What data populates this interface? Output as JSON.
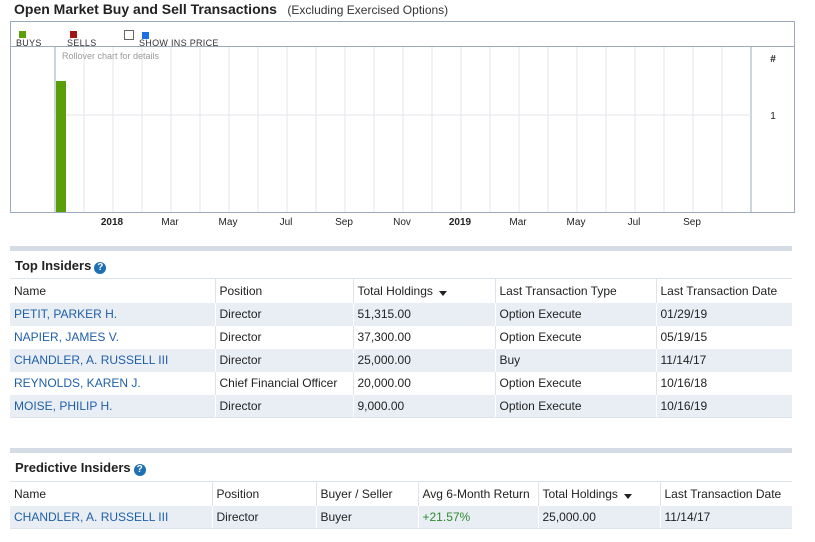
{
  "header": {
    "title": "Open Market Buy and Sell Transactions",
    "subtitle": "(Excluding Exercised Options)"
  },
  "legend": {
    "buys": "BUYS",
    "sells": "SELLS",
    "show_ins_price": "SHOW INS PRICE",
    "buys_color": "#5a9e0a",
    "sells_color": "#a31515",
    "price_color": "#1e6fe0"
  },
  "chart_data": {
    "type": "bar",
    "hint": "Rollover chart for details",
    "y_axis_label": "#",
    "y_ticks": [
      1
    ],
    "x_tick_labels": [
      {
        "label": "2018",
        "bold": true
      },
      {
        "label": "Mar",
        "bold": false
      },
      {
        "label": "May",
        "bold": false
      },
      {
        "label": "Jul",
        "bold": false
      },
      {
        "label": "Sep",
        "bold": false
      },
      {
        "label": "Nov",
        "bold": false
      },
      {
        "label": "2019",
        "bold": true
      },
      {
        "label": "Mar",
        "bold": false
      },
      {
        "label": "May",
        "bold": false
      },
      {
        "label": "Jul",
        "bold": false
      },
      {
        "label": "Sep",
        "bold": false
      }
    ],
    "series": [
      {
        "name": "BUYS",
        "color": "#5a9e0a",
        "points": [
          {
            "month_index": 0,
            "value": 1.35
          }
        ]
      }
    ],
    "ylim": [
      0,
      1.7
    ],
    "grid": true
  },
  "top_insiders": {
    "title": "Top Insiders",
    "columns": [
      "Name",
      "Position",
      "Total Holdings",
      "Last Transaction Type",
      "Last Transaction Date"
    ],
    "rows": [
      {
        "name": "PETIT, PARKER H.",
        "position": "Director",
        "holdings": "51,315.00",
        "type": "Option Execute",
        "date": "01/29/19"
      },
      {
        "name": "NAPIER, JAMES V.",
        "position": "Director",
        "holdings": "37,300.00",
        "type": "Option Execute",
        "date": "05/19/15"
      },
      {
        "name": "CHANDLER, A. RUSSELL III",
        "position": "Director",
        "holdings": "25,000.00",
        "type": "Buy",
        "date": "11/14/17"
      },
      {
        "name": "REYNOLDS, KAREN J.",
        "position": "Chief Financial Officer",
        "holdings": "20,000.00",
        "type": "Option Execute",
        "date": "10/16/18"
      },
      {
        "name": "MOISE, PHILIP H.",
        "position": "Director",
        "holdings": "9,000.00",
        "type": "Option Execute",
        "date": "10/16/19"
      }
    ]
  },
  "predictive_insiders": {
    "title": "Predictive Insiders",
    "columns": [
      "Name",
      "Position",
      "Buyer / Seller",
      "Avg 6-Month Return",
      "Total Holdings",
      "Last Transaction Date"
    ],
    "rows": [
      {
        "name": "CHANDLER, A. RUSSELL III",
        "position": "Director",
        "side": "Buyer",
        "ret": "+21.57%",
        "holdings": "25,000.00",
        "date": "11/14/17"
      }
    ]
  }
}
